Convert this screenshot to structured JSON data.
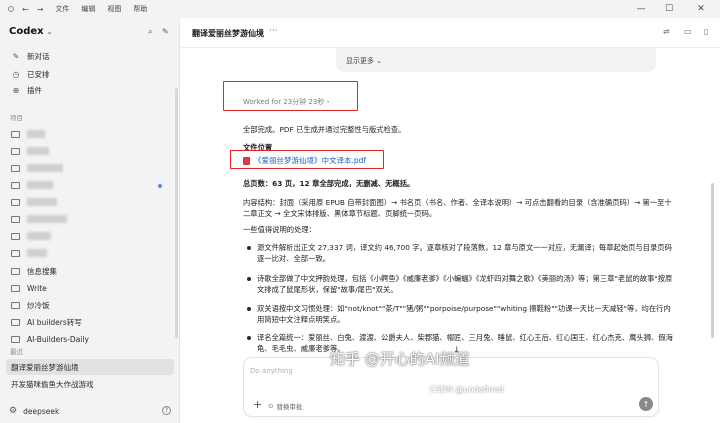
{
  "titlebar": {
    "menus": [
      "文件",
      "编辑",
      "视图",
      "帮助"
    ],
    "back_glyph": "←",
    "forward_glyph": "→"
  },
  "sidebar": {
    "app_name": "Codex",
    "top_items": [
      {
        "label": "新对话",
        "icon": "edit-icon"
      },
      {
        "label": "已安排",
        "icon": "clock-icon"
      },
      {
        "label": "插件",
        "icon": "plugin-icon"
      }
    ],
    "projects_label": "项目",
    "projects": [
      {
        "label": "信息搜集"
      },
      {
        "label": "Write"
      },
      {
        "label": "炒冷饭"
      },
      {
        "label": "AI builders转写"
      },
      {
        "label": "AI-Builders-Daily"
      }
    ],
    "recent_label": "最近",
    "recent": [
      {
        "label": "翻译爱丽丝梦游仙境"
      },
      {
        "label": "开发猫咪偷鱼大作战游戏"
      }
    ],
    "account": "deepseek"
  },
  "main": {
    "title": "翻译爱丽丝梦游仙境",
    "more": "···",
    "show_more": "显示更多",
    "worked": "Worked for 23分钟 23秒",
    "para1": "全部完成。PDF 已生成并通过完整性与版式检查。",
    "file_heading": "文件位置",
    "file_name": "《爱丽丝梦游仙境》中文译本.pdf",
    "summary": "总页数：63 页，12 章全部完成，无删减、无概括。",
    "structure": "内容结构：封面（采用原 EPUB 自带封面图）→ 书名页（书名、作者、全译本说明）→ 可点击翻看的目录（含准确页码）→ 第一至十二章正文 → 全文宋体排版、黑体章节标题、页脚统一页码。",
    "notes_heading": "一些值得说明的处理：",
    "bullets": [
      "源文件解析出正文 27,337 词，译文约 46,700 字。逐章核对了段落数，12 章与原文一一对应，无漏译；每章起始页与目录页码逐一比对、全部一致。",
      "诗歌全部做了中文押韵处理，包括《小鳄鱼》《威廉老爹》《小蝙蝠》《龙虾四对舞之歌》《美丽的汤》等；第三章\"老鼠的故事\"按原文排成了鼠尾形状，保留\"故事/尾巴\"双关。",
      "双关语按中文习惯处理：如\"not/knot\"\"茶/T\"\"猪/粥\"\"porpoise/purpose\"\"whiting 擦鞋粉\"\"功课一天比一天减轻\"等，均在行内用简短中文注释点明笑点。",
      "译名全篇统一：爱丽丝、白兔、渡渡、公爵夫人、柴郡猫、帽匠、三月兔、睡鼠、红心王后、红心国王、红心杰克、鹰头狮、假海龟、毛毛虫、威廉老爹等。"
    ],
    "composer_placeholder": "Do anything",
    "composer_mode": "替换审批",
    "plus_glyph": "+",
    "down_glyph": "↓",
    "send_glyph": "↑"
  },
  "watermarks": {
    "zhihu": "知乎 @开心的AI频道",
    "csdn": "CSDN @undefined"
  }
}
